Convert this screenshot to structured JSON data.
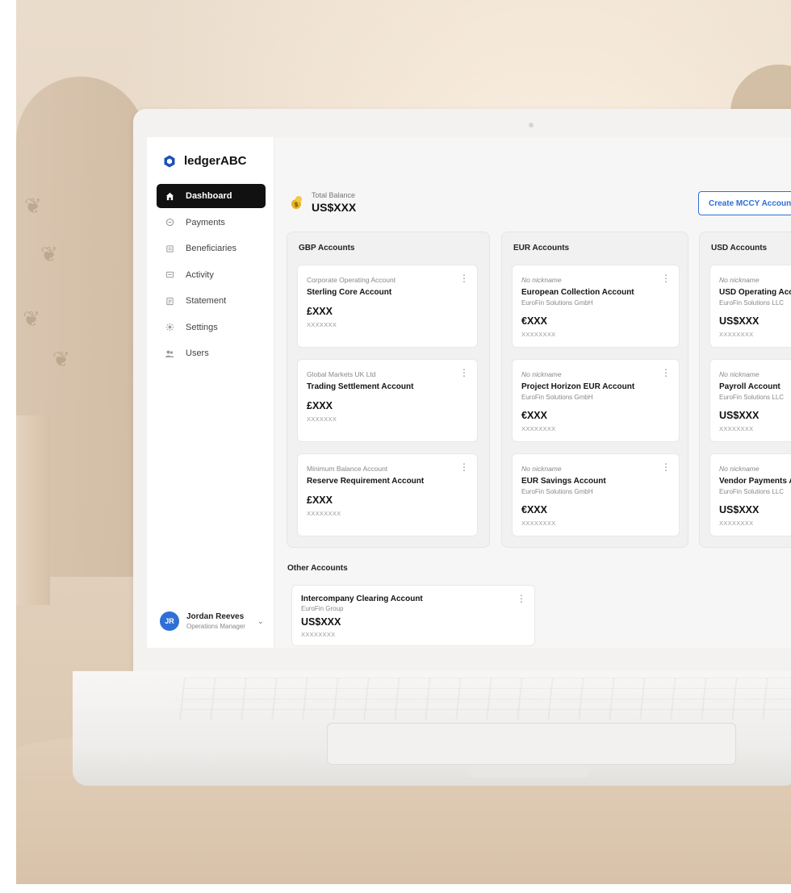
{
  "app": {
    "name": "ledgerABC"
  },
  "sidebar": {
    "items": [
      {
        "label": "Dashboard",
        "icon": "home-icon",
        "active": true
      },
      {
        "label": "Payments",
        "icon": "payments-icon",
        "active": false
      },
      {
        "label": "Beneficiaries",
        "icon": "beneficiaries-icon",
        "active": false
      },
      {
        "label": "Activity",
        "icon": "activity-icon",
        "active": false
      },
      {
        "label": "Statement",
        "icon": "statement-icon",
        "active": false
      },
      {
        "label": "Settings",
        "icon": "gear-icon",
        "active": false
      },
      {
        "label": "Users",
        "icon": "users-icon",
        "active": false
      }
    ],
    "user": {
      "initials": "JR",
      "name": "Jordan Reeves",
      "role": "Operations Manager"
    }
  },
  "header": {
    "balance_label": "Total Balance",
    "balance_value": "US$XXX",
    "create_button": "Create MCCY Account"
  },
  "groups": [
    {
      "title": "GBP Accounts",
      "accounts": [
        {
          "nickname": "Corporate Operating Account",
          "nickname_italic": false,
          "name": "Sterling Core Account",
          "entity": "",
          "balance": "£XXX",
          "number": "XXXXXXX"
        },
        {
          "nickname": "Global Markets UK Ltd",
          "nickname_italic": false,
          "name": "Trading Settlement Account",
          "entity": "",
          "balance": "£XXX",
          "number": "XXXXXXX"
        },
        {
          "nickname": "Minimum Balance Account",
          "nickname_italic": false,
          "name": "Reserve Requirement Account",
          "entity": "",
          "balance": "£XXX",
          "number": "XXXXXXXX"
        }
      ]
    },
    {
      "title": "EUR Accounts",
      "accounts": [
        {
          "nickname": "No nickname",
          "nickname_italic": true,
          "name": "European Collection Account",
          "entity": "EuroFin Solutions GmbH",
          "balance": "€XXX",
          "number": "XXXXXXXX"
        },
        {
          "nickname": "No nickname",
          "nickname_italic": true,
          "name": "Project Horizon EUR Account",
          "entity": "EuroFin Solutions GmbH",
          "balance": "€XXX",
          "number": "XXXXXXXX"
        },
        {
          "nickname": "No nickname",
          "nickname_italic": true,
          "name": "EUR Savings Account",
          "entity": "EuroFin Solutions GmbH",
          "balance": "€XXX",
          "number": "XXXXXXXX"
        }
      ]
    },
    {
      "title": "USD Accounts",
      "accounts": [
        {
          "nickname": "No nickname",
          "nickname_italic": true,
          "name": "USD Operating Acc",
          "entity": "EuroFin Solutions LLC",
          "balance": "US$XXX",
          "number": "XXXXXXXX"
        },
        {
          "nickname": "No nickname",
          "nickname_italic": true,
          "name": "Payroll Account",
          "entity": "EuroFin Solutions LLC",
          "balance": "US$XXX",
          "number": "XXXXXXXX"
        },
        {
          "nickname": "No nickname",
          "nickname_italic": true,
          "name": "Vendor Payments A",
          "entity": "EuroFin Solutions LLC",
          "balance": "US$XXX",
          "number": "XXXXXXXX"
        }
      ]
    }
  ],
  "other": {
    "title": "Other Accounts",
    "account": {
      "name": "Intercompany Clearing Account",
      "entity": "EuroFin Group",
      "balance": "US$XXX",
      "number": "XXXXXXXX"
    }
  },
  "colors": {
    "accent": "#2f6fd6",
    "active_nav": "#111111",
    "background": "#e7d9c8"
  }
}
